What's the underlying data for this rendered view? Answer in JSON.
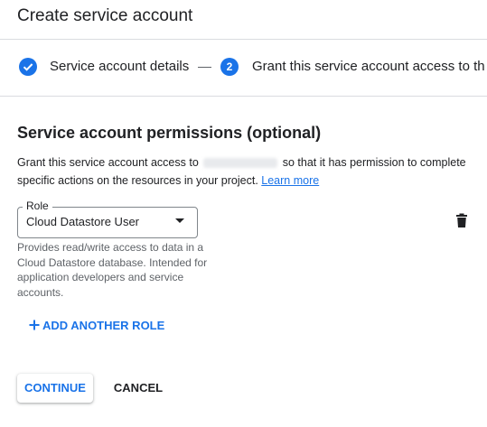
{
  "header": {
    "title": "Create service account"
  },
  "stepper": {
    "steps": [
      {
        "number": "",
        "label": "Service account details",
        "icon": "check-circle-icon",
        "state": "complete"
      },
      {
        "number": "2",
        "label": "Grant this service account access to th",
        "state": "active"
      }
    ]
  },
  "permissions": {
    "heading": "Service account permissions (optional)",
    "description_before": "Grant this service account access to",
    "description_after": "so that it has permission to complete specific actions on the resources in your project.",
    "learn_more": "Learn more"
  },
  "role": {
    "label": "Role",
    "selected": "Cloud Datastore User",
    "hint": "Provides read/write access to data in a Cloud Datastore database. Intended for application developers and service accounts.",
    "delete_icon": "trash-icon"
  },
  "actions": {
    "add_role": "ADD ANOTHER ROLE",
    "continue": "CONTINUE",
    "cancel": "CANCEL"
  },
  "colors": {
    "accent": "#1a73e8",
    "text": "#202124",
    "muted": "#5f6368",
    "divider": "#dadce0"
  }
}
